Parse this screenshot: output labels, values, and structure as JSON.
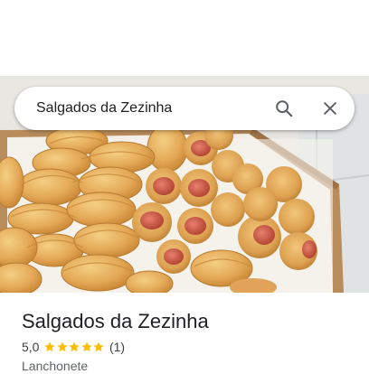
{
  "search": {
    "query": "Salgados da Zezinha",
    "search_icon": "search-icon",
    "clear_icon": "close-icon"
  },
  "photo": {
    "subject": "fried pastries and mini sausage rolls in a cardboard box"
  },
  "place": {
    "name": "Salgados da Zezinha",
    "rating": "5,0",
    "stars": 5,
    "review_count": "(1)",
    "category": "Lanchonete"
  },
  "colors": {
    "star": "#fbbc04",
    "text_primary": "#202124",
    "text_secondary": "#5f6368",
    "icon": "#5f6368"
  }
}
